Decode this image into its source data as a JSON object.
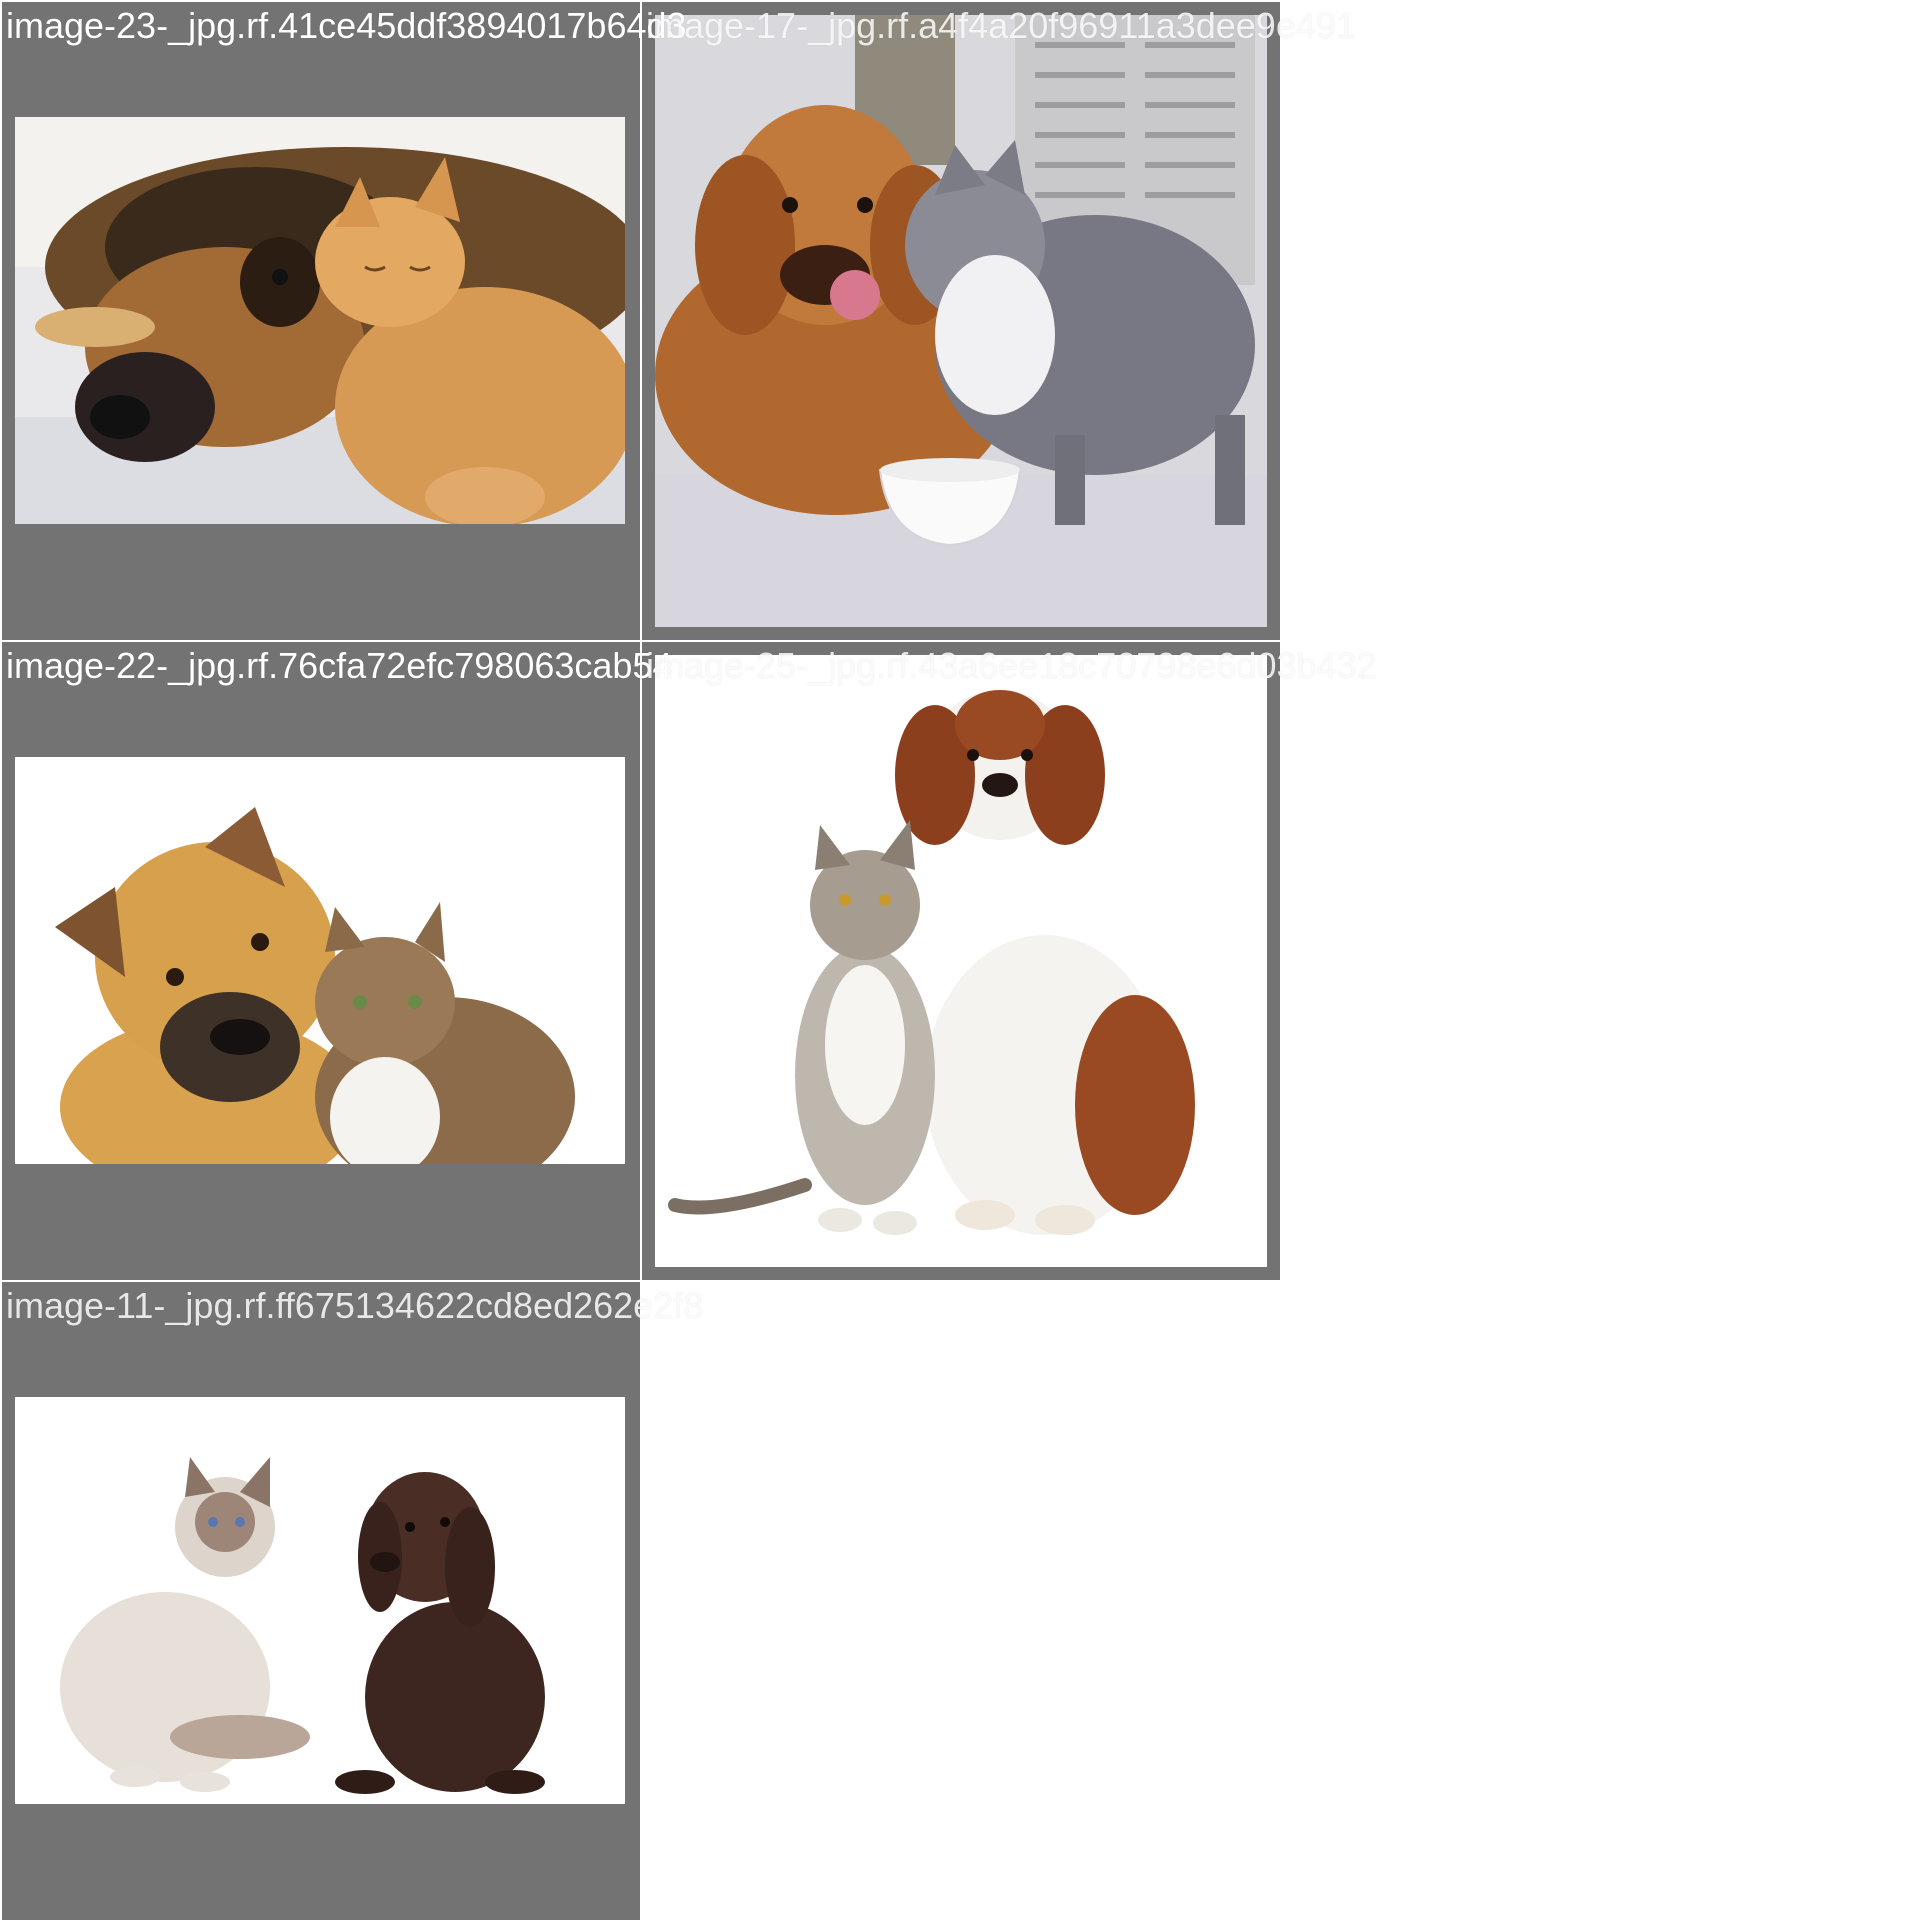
{
  "tiles": [
    {
      "label": "image-23-_jpg.rf.41ce45ddf3894017b64d3",
      "subject": "german shepherd lying with orange tabby cat"
    },
    {
      "label": "image-17-_jpg.rf.a4f4a20f96911a3dee9e491",
      "subject": "golden retriever licking nose beside grey and white cat and white bowl"
    },
    {
      "label": "image-22-_jpg.rf.76cfa72efc798063cab54",
      "subject": "tan dog tilting head next to tabby cat on white background"
    },
    {
      "label": "image-25-_jpg.rf.43a6ee18c70798e6d03b432",
      "subject": "tabby cat sitting beside brown and white spaniel on white background"
    },
    {
      "label": "image-11-_jpg.rf.ff675134622cd8ed262e2f8",
      "subject": "fluffy ragdoll cat and chocolate labrador puppy on white background"
    }
  ],
  "colors": {
    "tile_background": "#737373",
    "label_text": "#ffffff",
    "page_background": "#ffffff"
  }
}
